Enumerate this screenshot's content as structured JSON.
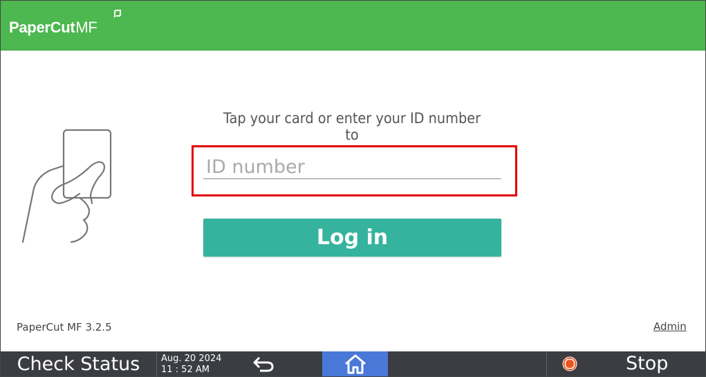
{
  "header": {
    "brand": "PaperCut",
    "brand_suffix": "MF",
    "background_color": "#4cb84f"
  },
  "login": {
    "prompt": "Tap your card or enter your ID number to",
    "id_placeholder": "ID number",
    "id_value": "",
    "login_label": "Log in",
    "button_color": "#35b39e",
    "highlight_color": "#e00000"
  },
  "footer": {
    "version": "PaperCut MF 3.2.5",
    "admin_label": "Admin"
  },
  "system_bar": {
    "check_status_label": "Check Status",
    "date": "Aug. 20 2024",
    "time": "11 : 52 AM",
    "back_icon": "back-arrow-icon",
    "home_icon": "home-icon",
    "stop_icon": "stop-icon",
    "stop_label": "Stop",
    "home_color": "#4a78d8"
  }
}
